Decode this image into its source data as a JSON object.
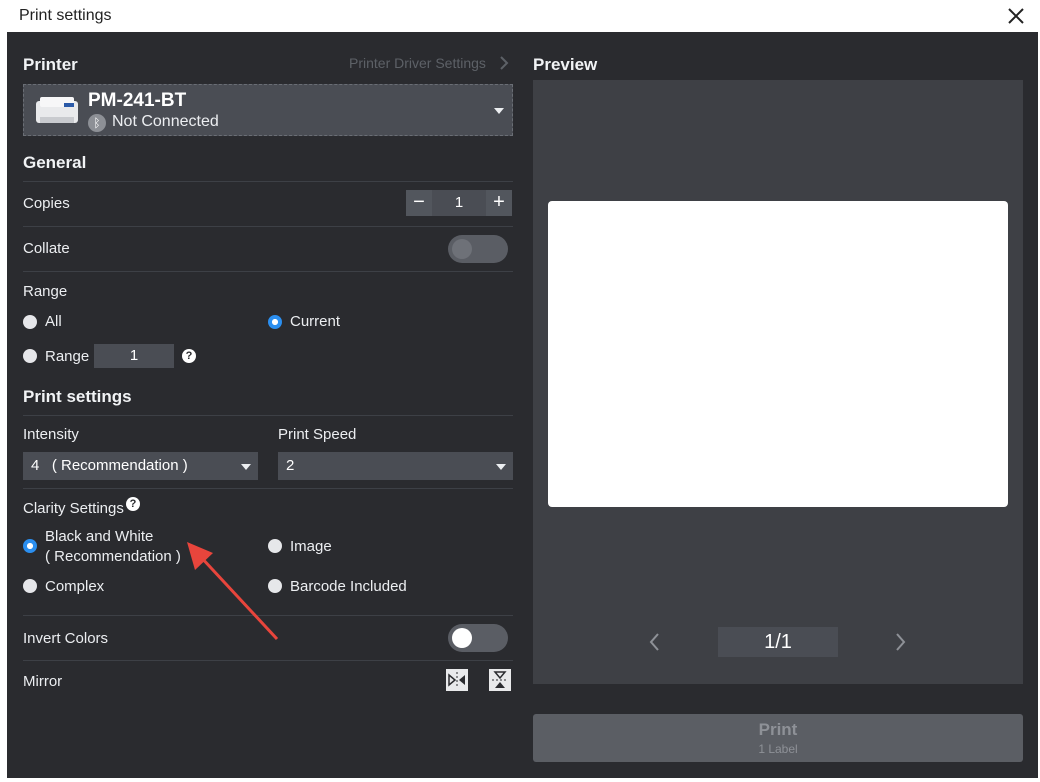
{
  "window": {
    "title": "Print settings"
  },
  "printer": {
    "heading": "Printer",
    "driver_link": "Printer Driver Settings",
    "name": "PM-241-BT",
    "status": "Not Connected"
  },
  "general": {
    "heading": "General",
    "copies_label": "Copies",
    "copies_value": "1",
    "collate_label": "Collate",
    "range_label": "Range",
    "all_label": "All",
    "current_label": "Current",
    "range_option_label": "Range",
    "range_value": "1"
  },
  "print_settings": {
    "heading": "Print settings",
    "intensity_label": "Intensity",
    "intensity_value": "4   ( Recommendation )",
    "speed_label": "Print Speed",
    "speed_value": "2",
    "clarity_label": "Clarity Settings",
    "bw_line1": "Black and White",
    "bw_line2": "( Recommendation )",
    "image_label": "Image",
    "complex_label": "Complex",
    "barcode_label": "Barcode Included",
    "invert_label": "Invert Colors",
    "mirror_label": "Mirror"
  },
  "preview": {
    "heading": "Preview",
    "page_indicator": "1/1"
  },
  "print_button": {
    "label": "Print",
    "sub_label": "1 Label"
  },
  "colors": {
    "accent": "#2b8ff0",
    "panel": "#2a2b2f",
    "arrow": "#e8453c"
  }
}
